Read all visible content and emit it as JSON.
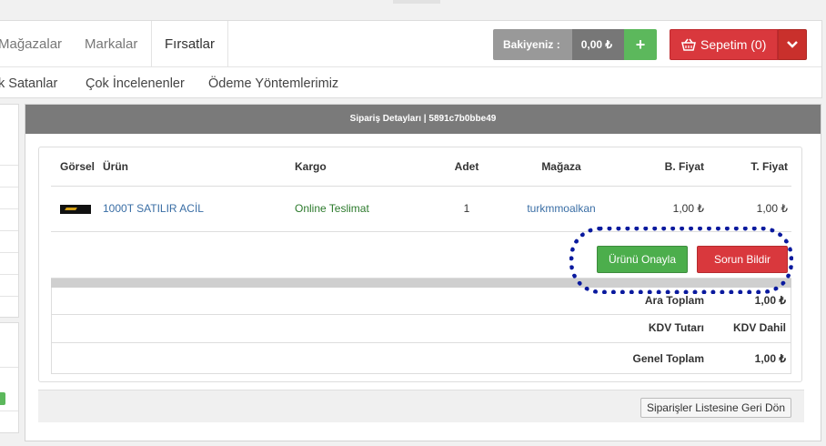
{
  "nav": {
    "row1": [
      "Mağazalar",
      "Markalar",
      "Fırsatlar"
    ],
    "row2": [
      "k Satanlar",
      "Çok İncelenenler",
      "Ödeme Yöntemlerimiz"
    ]
  },
  "balance": {
    "label": "Bakiyeniz :",
    "value": "0,00 ₺",
    "plus": "+"
  },
  "cart": {
    "label": "Sepetim (0)"
  },
  "order": {
    "title": "Sipariş Detayları | 5891c7b0bbe49",
    "columns": [
      "Görsel",
      "Ürün",
      "Kargo",
      "Adet",
      "Mağaza",
      "B. Fiyat",
      "T. Fiyat"
    ],
    "rows": [
      {
        "product": "1000T SATILIR ACİL",
        "cargo": "Online Teslimat",
        "qty": "1",
        "store": "turkmmoalkan",
        "unit_price": "1,00 ₺",
        "total_price": "1,00 ₺"
      }
    ],
    "actions": {
      "approve": "Ürünü Onayla",
      "report": "Sorun Bildir"
    },
    "summary": [
      {
        "label": "Ara Toplam",
        "value": "1,00 ₺"
      },
      {
        "label": "KDV Tutarı",
        "value": "KDV Dahil"
      },
      {
        "label": "Genel Toplam",
        "value": "1,00 ₺"
      }
    ],
    "back_button": "Siparişler Listesine Geri Dön"
  },
  "colors": {
    "approve": "#4cae4c",
    "report": "#d9383d",
    "highlight": "#0a1a9e"
  }
}
